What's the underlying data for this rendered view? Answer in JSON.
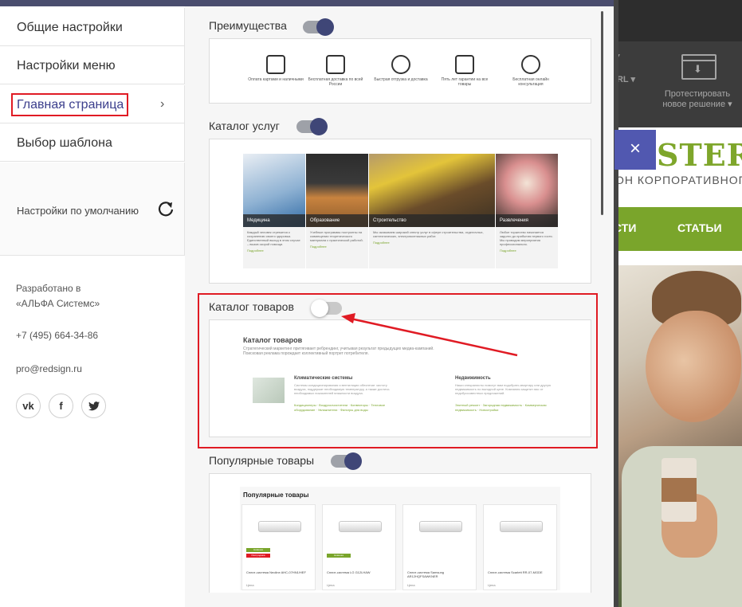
{
  "left_menu": {
    "items": [
      {
        "label": "Общие настройки"
      },
      {
        "label": "Настройки меню"
      },
      {
        "label": "Главная страница"
      },
      {
        "label": "Выбор шаблона"
      }
    ],
    "defaults_label": "Настройки по умолчанию"
  },
  "info": {
    "developed_by_line1": "Разработано в",
    "developed_by_line2": "«АЛЬФА Системс»",
    "phone": "+7 (495) 664-34-86",
    "email": "pro@redsign.ru",
    "social": [
      "vk-icon",
      "facebook-icon",
      "twitter-icon"
    ]
  },
  "sections": {
    "advantages": {
      "title": "Преимущества",
      "enabled": true,
      "items": [
        {
          "icon": "wallet-icon",
          "text": "Оплата картами и наличными"
        },
        {
          "icon": "cart-icon",
          "text": "Бесплатная доставка по всей России"
        },
        {
          "icon": "clock-icon",
          "text": "Быстрая отгрузка и доставка"
        },
        {
          "icon": "document-icon",
          "text": "Пять лет гарантии на все товары"
        },
        {
          "icon": "chat-icon",
          "text": "Бесплатная онлайн консультация"
        }
      ]
    },
    "services": {
      "title": "Каталог услуг",
      "enabled": true,
      "items": [
        {
          "caption": "Медицина",
          "text": "Каждый человек стремится к сохранению своего здоровья. Единственный выход в этом случае – вызов скорой помощи.",
          "more": "Подробнее"
        },
        {
          "caption": "Образование",
          "text": "Учебные программы построены на совмещении теоретического материала с практической работой.",
          "more": "Подробнее"
        },
        {
          "caption": "Строительство",
          "text": "Мы оказываем широкий спектр услуг в сфере строительства, отделочных, сантехнических, электромонтажных работ.",
          "more": "Подробнее"
        },
        {
          "caption": "Развлечения",
          "text": "Любое торжество начинается задолго до прибытия первого гостя. Мы проводим мероприятия профессионально.",
          "more": "Подробнее"
        }
      ]
    },
    "products": {
      "title": "Каталог товаров",
      "enabled": false,
      "inner_title": "Каталог товаров",
      "inner_desc": "Стратегический маркетинг притягивает ребрендинг, учитывая результат предыдущих медиа-кампаний. Поисковая реклама порождает коллективный портрет потребителя.",
      "cat1": {
        "title": "Климатические системы",
        "text": "Системы кондиционирования и вентиляции обеспечат чистоту воздуха, поддержат необходимую температуру, а также достичь необходимых показателей влажности воздуха.",
        "links": "Кондиционеры · Воздухоочистители · Конвекторы · Тепловое оборудование · Увлажнители · Фильтры для воды"
      },
      "cat2": {
        "title": "Недвижимость",
        "text": "Наши специалисты помогут вам подобрать квартиру или другую недвижимость по выгодной цене. Компания защитит вас от недобросовестных предложений.",
        "links": "Элитный ремонт · Загородная недвижимость · Коммерческая недвижимость · Новостройки"
      }
    },
    "popular": {
      "title": "Популярные товары",
      "enabled": true,
      "inner_title": "Популярные товары",
      "items": [
        {
          "name": "Сплит-система Neoline AHC-07HN1/HEF",
          "price": "Цена",
          "badges": [
            "Новинка",
            "Распродажа"
          ]
        },
        {
          "name": "Сплит-система LG G12LHAW",
          "price": "Цена",
          "badges": [
            "Новинка"
          ]
        },
        {
          "name": "Сплит-система Samsung AR12HQFSAWKNER",
          "price": "Цена",
          "badges": []
        },
        {
          "name": "Сплит-система Scarlett RR-07-MGDE",
          "price": "Цена",
          "badges": []
        }
      ]
    }
  },
  "site": {
    "url_fragment": "URL",
    "test_solution": "Протестировать новое решение",
    "logo": "STER",
    "subtitle": "ОН КОРПОРАТИВНОГО",
    "nav": [
      "СТИ",
      "СТАТЬИ"
    ],
    "close": "×"
  },
  "colors": {
    "accent": "#3f4677",
    "highlight": "#e01b24",
    "green": "#7aa52b"
  }
}
